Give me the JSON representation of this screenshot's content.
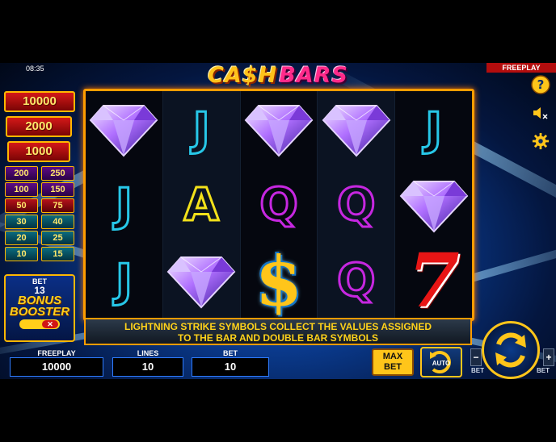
{
  "status": {
    "clock": "08:35",
    "mode": "FREEPLAY"
  },
  "logo": {
    "cash": "CA$H",
    "bars": "BARS"
  },
  "jackpots": [
    "10000",
    "2000",
    "1000"
  ],
  "paytable": [
    {
      "left": "200",
      "right": "250",
      "color": "purple"
    },
    {
      "left": "100",
      "right": "150",
      "color": "purple"
    },
    {
      "left": "50",
      "right": "75",
      "color": "red"
    },
    {
      "left": "30",
      "right": "40",
      "color": "teal"
    },
    {
      "left": "20",
      "right": "25",
      "color": "teal"
    },
    {
      "left": "10",
      "right": "15",
      "color": "teal"
    }
  ],
  "booster": {
    "bet_label": "BET",
    "bet_value": "13",
    "title_line1": "BONUS",
    "title_line2": "BOOSTER",
    "toggle": "✕"
  },
  "reels": [
    [
      "diamond",
      "J",
      "J"
    ],
    [
      "J",
      "A",
      "diamond"
    ],
    [
      "diamond",
      "Q",
      "$"
    ],
    [
      "diamond",
      "Q",
      "Q"
    ],
    [
      "J",
      "diamond",
      "7"
    ]
  ],
  "message": {
    "line1": "LIGHTNING STRIKE SYMBOLS COLLECT THE VALUES ASSIGNED",
    "line2": "TO THE BAR AND DOUBLE BAR SYMBOLS"
  },
  "controls": {
    "freeplay_label": "FREEPLAY",
    "freeplay_value": "10000",
    "lines_label": "LINES",
    "lines_value": "10",
    "bet_label": "BET",
    "bet_value": "10",
    "max_bet_line1": "MAX",
    "max_bet_line2": "BET",
    "auto_label": "AUTO",
    "bet_minus": "−",
    "bet_plus": "+",
    "bet_mini_label": "BET"
  },
  "icons": {
    "help": "help-icon",
    "sound": "sound-muted-icon",
    "settings": "gear-icon"
  },
  "colors": {
    "frame": "#ff9c00",
    "accent": "#ffc51a",
    "jackpot": "#d41818"
  }
}
